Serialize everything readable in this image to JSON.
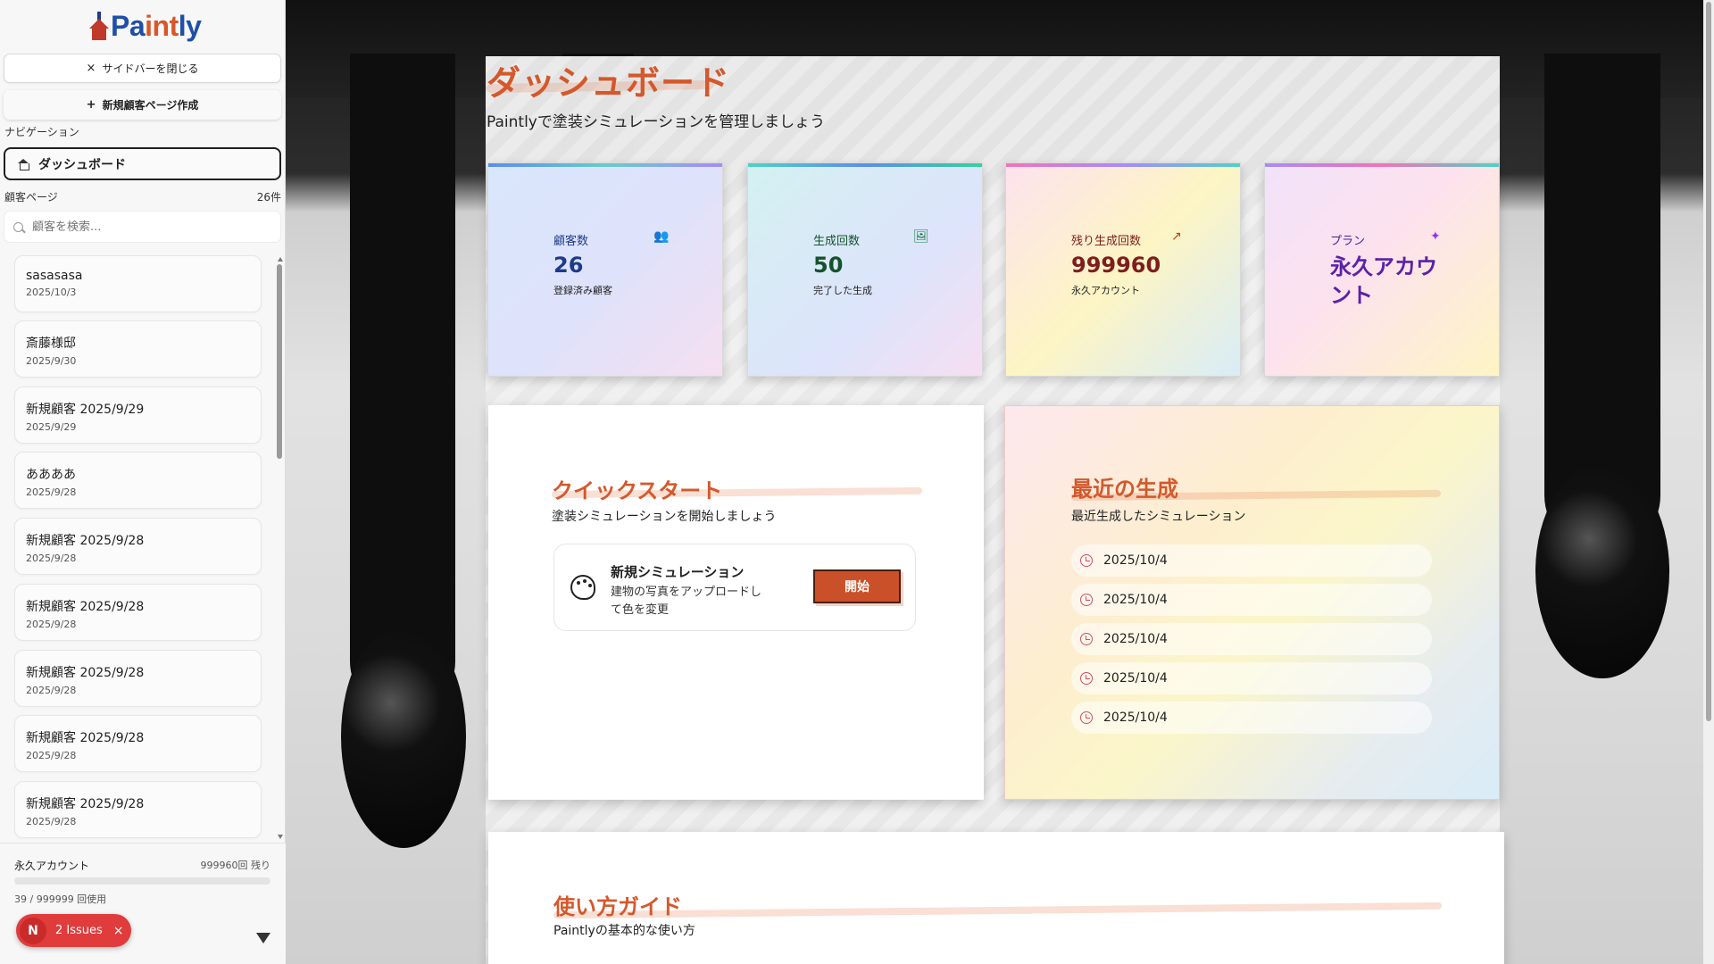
{
  "app": {
    "logo_text_pre": "Pa",
    "logo_text_accent": "int",
    "logo_text_post": "ly"
  },
  "sidebar": {
    "close_label": "サイドバーを閉じる",
    "close_glyph": "×",
    "new_label": "新規顧客ページ作成",
    "new_glyph": "+",
    "nav_label": "ナビゲーション",
    "dashboard_label": "ダッシュボード",
    "customers_label": "顧客ページ",
    "customers_count": "26件",
    "search_placeholder": "顧客を検索...",
    "customers": [
      {
        "name": "sasasasa",
        "date": "2025/10/3"
      },
      {
        "name": "斎藤様邸",
        "date": "2025/9/30"
      },
      {
        "name": "新規顧客 2025/9/29",
        "date": "2025/9/29"
      },
      {
        "name": "ああああ",
        "date": "2025/9/28"
      },
      {
        "name": "新規顧客 2025/9/28",
        "date": "2025/9/28"
      },
      {
        "name": "新規顧客 2025/9/28",
        "date": "2025/9/28"
      },
      {
        "name": "新規顧客 2025/9/28",
        "date": "2025/9/28"
      },
      {
        "name": "新規顧客 2025/9/28",
        "date": "2025/9/28"
      },
      {
        "name": "新規顧客 2025/9/28",
        "date": "2025/9/28"
      }
    ],
    "plan_name": "永久アカウント",
    "plan_remaining": "999960回 残り",
    "usage_text": "39 / 999999 回使用",
    "usage_fraction": 4e-05,
    "issues_badge": "N",
    "issues_label": "2 Issues",
    "issues_close": "×"
  },
  "dashboard": {
    "title": "ダッシュボード",
    "subtitle": "Paintlyで塗装シミュレーションを管理しましょう",
    "stats": [
      {
        "label": "顧客数",
        "value": "26",
        "sub": "登録済み顧客",
        "icon": "users-icon",
        "color": "#1e3a8a",
        "glyph": "👥"
      },
      {
        "label": "生成回数",
        "value": "50",
        "sub": "完了した生成",
        "icon": "image-icon",
        "color": "#14532d",
        "glyph": "🖼"
      },
      {
        "label": "残り生成回数",
        "value": "999960",
        "sub": "永久アカウント",
        "icon": "trending-up-icon",
        "color": "#7f1d1d",
        "glyph": "↗"
      },
      {
        "label": "プラン",
        "value": "永久アカウント",
        "icon": "sparkles-icon",
        "color": "#5b21a8",
        "glyph": "✦"
      }
    ],
    "quick_start": {
      "title": "クイックスタート",
      "subtitle": "塗装シミュレーションを開始しましょう",
      "sim_title": "新規シミュレーション",
      "sim_desc": "建物の写真をアップロードして色を変更",
      "start_label": "開始"
    },
    "recent": {
      "title": "最近の生成",
      "subtitle": "最近生成したシミュレーション",
      "items": [
        "2025/10/4",
        "2025/10/4",
        "2025/10/4",
        "2025/10/4",
        "2025/10/4"
      ]
    },
    "guide": {
      "title": "使い方ガイド",
      "subtitle": "Paintlyの基本的な使い方"
    }
  }
}
